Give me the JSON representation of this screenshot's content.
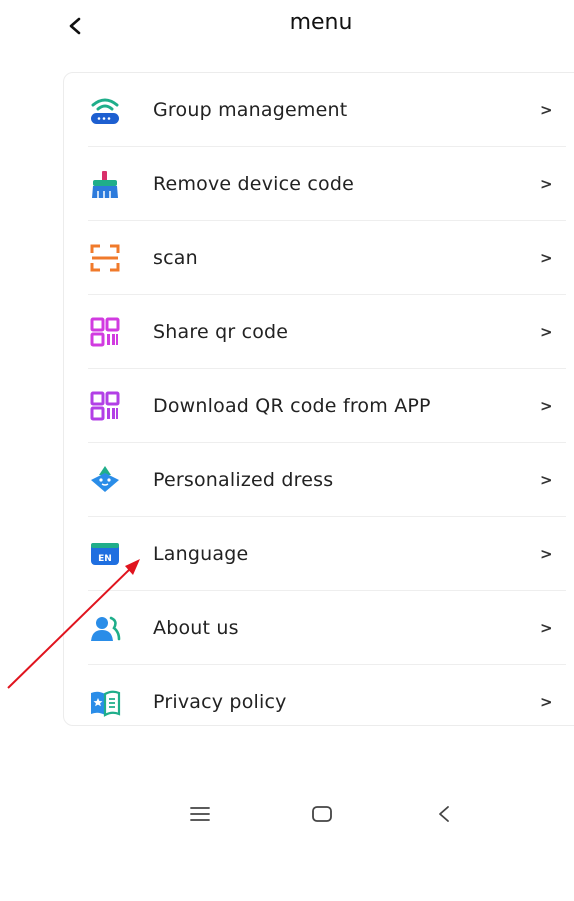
{
  "header": {
    "title": "menu",
    "back_icon": "chevron-left-icon"
  },
  "menu": {
    "items": [
      {
        "label": "Group management",
        "icon": "router-wifi-icon",
        "color": "#1fae8a"
      },
      {
        "label": "Remove device code",
        "icon": "broom-icon",
        "color": "#2d7bdc"
      },
      {
        "label": "scan",
        "icon": "scan-frame-icon",
        "color": "#f07a2b"
      },
      {
        "label": "Share qr code",
        "icon": "qr-code-icon",
        "color": "#d13be0"
      },
      {
        "label": "Download QR code from APP",
        "icon": "qr-code-icon",
        "color": "#b23fe6"
      },
      {
        "label": "Personalized dress",
        "icon": "robot-face-icon",
        "color": "#2a8de8"
      },
      {
        "label": "Language",
        "icon": "language-en-icon",
        "color": "#1f6fe0",
        "badge": "EN"
      },
      {
        "label": "About us",
        "icon": "users-icon",
        "color": "#2a8de8"
      },
      {
        "label": "Privacy policy",
        "icon": "book-icon",
        "color": "#2a8de8"
      }
    ],
    "chevron": ">"
  },
  "annotation": {
    "color": "#e0141e"
  },
  "nav": {
    "menu_icon": "menu-lines-icon",
    "home_icon": "home-square-icon",
    "back_icon": "back-triangle-icon",
    "back_glyph": "<"
  }
}
